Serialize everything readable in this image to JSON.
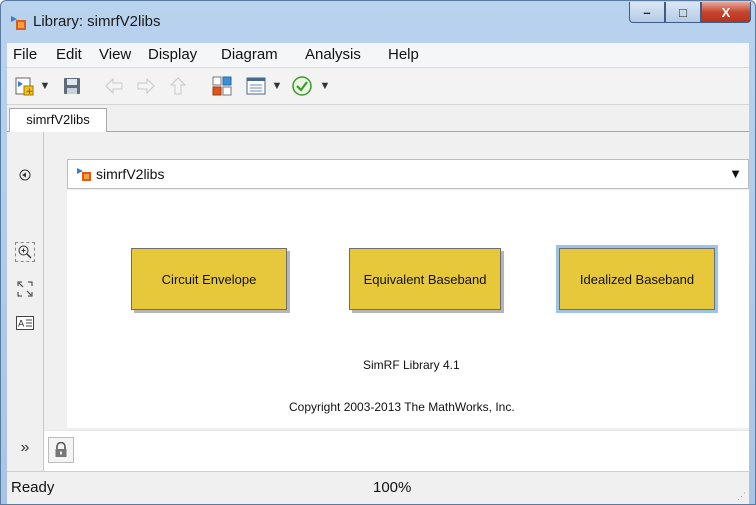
{
  "window": {
    "title": "Library: simrfV2libs",
    "controls": {
      "minimize": "–",
      "maximize": "□",
      "close": "X"
    }
  },
  "menu": [
    "File",
    "Edit",
    "View",
    "Display",
    "Diagram",
    "Analysis",
    "Help"
  ],
  "toolbar": {
    "icons": [
      "new-model-icon",
      "save-icon",
      "back-icon",
      "forward-icon",
      "up-icon",
      "library-browser-icon",
      "model-explorer-icon",
      "check-icon"
    ]
  },
  "tabs": [
    {
      "label": "simrfV2libs"
    }
  ],
  "address": {
    "path": "simrfV2libs"
  },
  "blocks": [
    {
      "label": "Circuit Envelope"
    },
    {
      "label": "Equivalent Baseband"
    },
    {
      "label": "Idealized Baseband"
    }
  ],
  "library": {
    "version": "SimRF Library 4.1",
    "copyright": "Copyright 2003-2013 The MathWorks, Inc."
  },
  "status": {
    "left": "Ready",
    "zoom": "100%"
  },
  "colors": {
    "block_fill": "#e6c83a",
    "selection": "#9cc4ea",
    "check_green": "#3a9a2a"
  }
}
